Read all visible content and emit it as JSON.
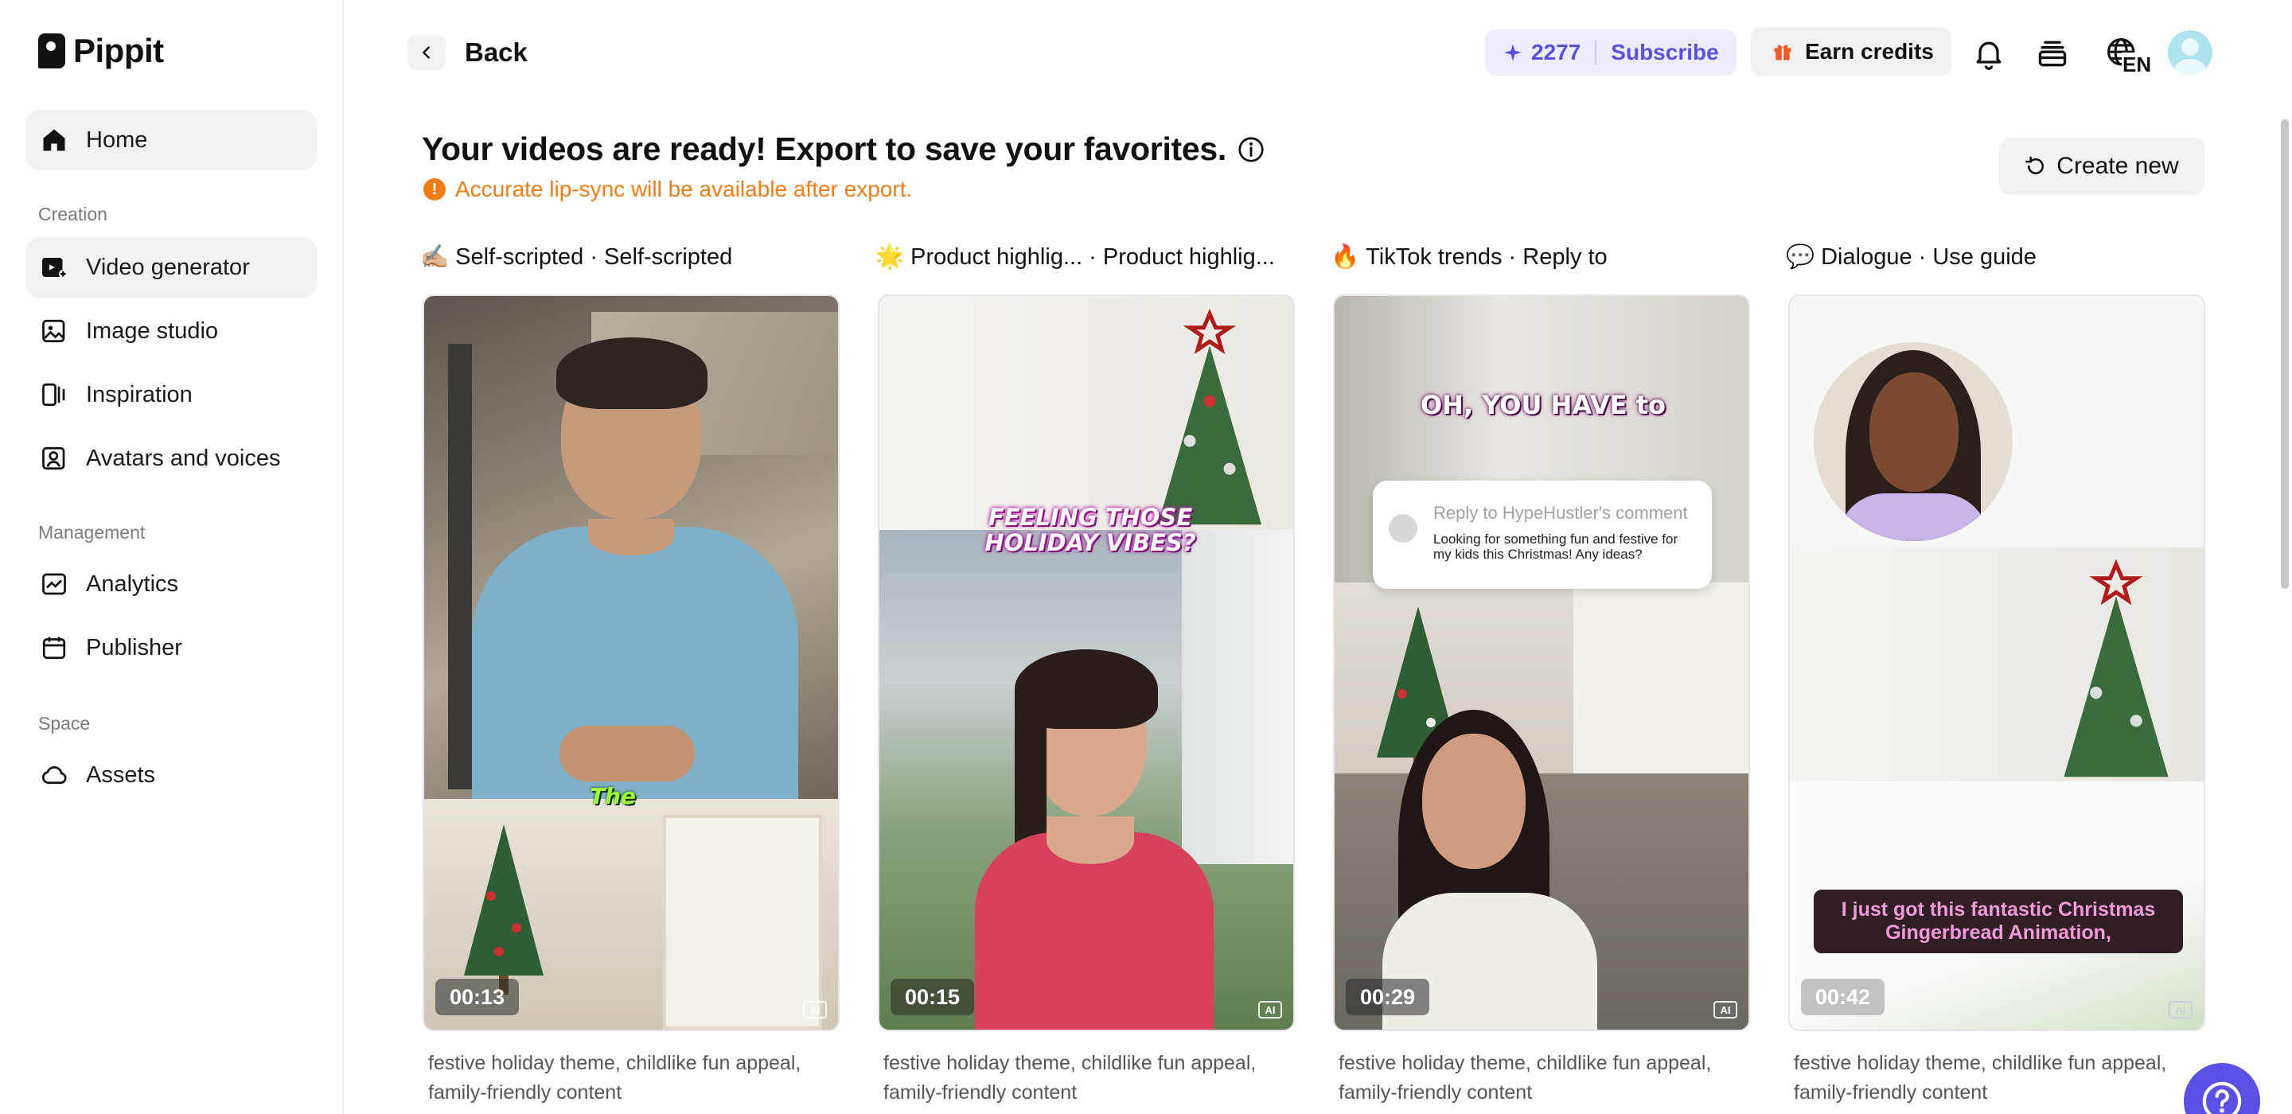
{
  "brand": {
    "name": "Pippit"
  },
  "sidebar": {
    "home": "Home",
    "creation_label": "Creation",
    "creation_items": [
      "Video generator",
      "Image studio",
      "Inspiration",
      "Avatars and voices"
    ],
    "management_label": "Management",
    "management_items": [
      "Analytics",
      "Publisher"
    ],
    "space_label": "Space",
    "space_items": [
      "Assets"
    ],
    "active_item": "Video generator"
  },
  "header": {
    "back_label": "Back",
    "credits": "2277",
    "subscribe_label": "Subscribe",
    "earn_label": "Earn credits",
    "language": "EN",
    "icons": [
      "bell-icon",
      "stack-icon",
      "globe-icon"
    ]
  },
  "main": {
    "title": "Your videos are ready! Export to save your favorites.",
    "warning": "Accurate lip-sync will be available after export.",
    "create_new_label": "Create new",
    "accent_color": "#5b50e6",
    "warning_color": "#f07d16",
    "cards": [
      {
        "emoji": "✍🏼",
        "head": "Self-scripted · Self-scripted",
        "duration": "00:13",
        "caption": "The",
        "description": "festive holiday theme, childlike fun appeal, family-friendly content"
      },
      {
        "emoji": "🌟",
        "head": "Product highlig...   · Product highlig...",
        "duration": "00:15",
        "caption": "FEELING THOSE HOLIDAY VIBES?",
        "description": "festive holiday theme, childlike fun appeal, family-friendly content"
      },
      {
        "emoji": "🔥",
        "head": "TikTok trends · Reply to",
        "duration": "00:29",
        "caption": "OH, YOU HAVE to",
        "reply_title": "Reply to HypeHustler's comment",
        "reply_text": "Looking for something fun and festive for my kids this Christmas! Any ideas?",
        "description": "festive holiday theme, childlike fun appeal, family-friendly content"
      },
      {
        "emoji": "💬",
        "head": "Dialogue · Use guide",
        "duration": "00:42",
        "caption": "I just got this fantastic Christmas Gingerbread Animation,",
        "description": "festive holiday theme, childlike fun appeal, family-friendly content"
      }
    ],
    "ai_badge": "AI"
  }
}
